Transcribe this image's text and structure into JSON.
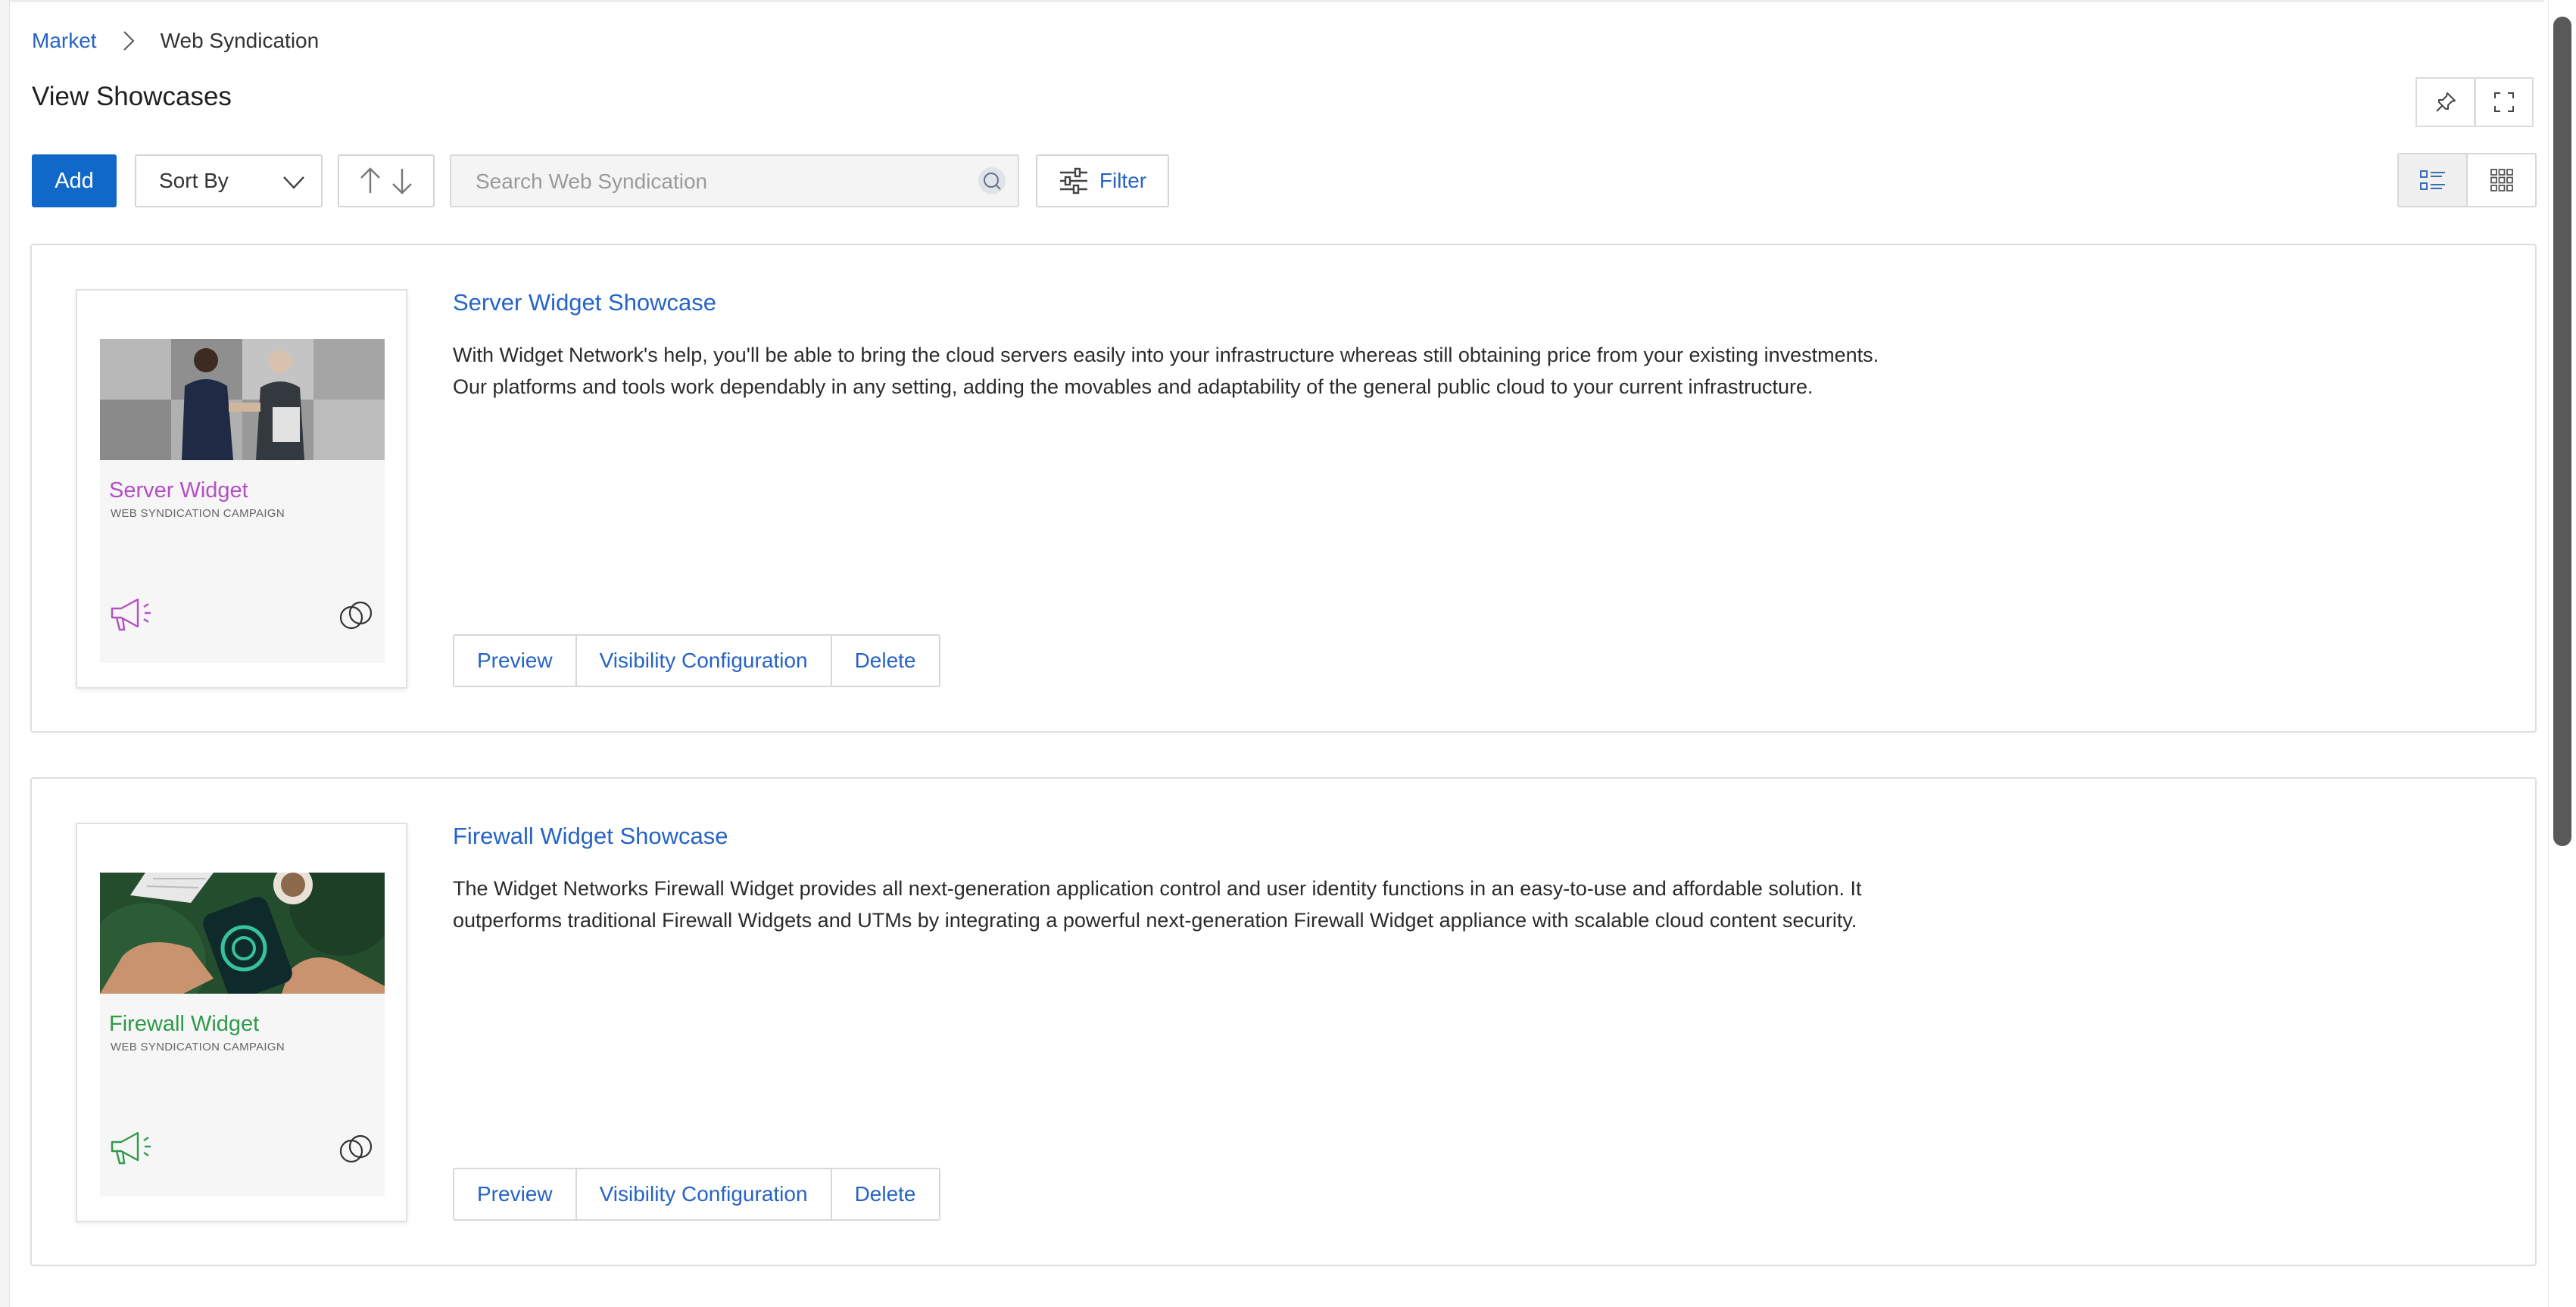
{
  "breadcrumb": {
    "root": "Market",
    "current": "Web Syndication"
  },
  "page": {
    "title": "View Showcases"
  },
  "toolbar": {
    "add_label": "Add",
    "sort_label": "Sort By",
    "search_placeholder": "Search Web Syndication",
    "filter_label": "Filter"
  },
  "showcases": [
    {
      "title": "Server Widget Showcase",
      "description": "With Widget Network's help, you'll be able to bring the cloud servers easily into your infrastructure whereas still obtaining price from your existing investments. Our platforms and tools work dependably in any setting, adding the movables and adaptability of the general public cloud to your current infrastructure.",
      "thumbnail": {
        "name": "Server Widget",
        "subtitle": "WEB SYNDICATION CAMPAIGN",
        "accent": "#b44fc4"
      },
      "actions": {
        "preview": "Preview",
        "visibility": "Visibility Configuration",
        "delete": "Delete"
      }
    },
    {
      "title": "Firewall Widget Showcase",
      "description": "The Widget Networks Firewall Widget provides all next-generation application control and user identity functions in an easy-to-use and affordable solution. It outperforms traditional Firewall Widgets and UTMs by integrating a powerful next-generation Firewall Widget appliance with scalable cloud content security.",
      "thumbnail": {
        "name": "Firewall Widget",
        "subtitle": "WEB SYNDICATION CAMPAIGN",
        "accent": "#2e9a4a"
      },
      "actions": {
        "preview": "Preview",
        "visibility": "Visibility Configuration",
        "delete": "Delete"
      }
    }
  ],
  "colors": {
    "primary": "#1069c9",
    "link": "#2563c7"
  },
  "icons": [
    "chevron-right-icon",
    "pin-icon",
    "fullscreen-icon",
    "chevron-down-icon",
    "sort-asc-icon",
    "sort-desc-icon",
    "search-icon",
    "sliders-icon",
    "list-view-icon",
    "grid-view-icon",
    "megaphone-icon",
    "link-icon"
  ]
}
